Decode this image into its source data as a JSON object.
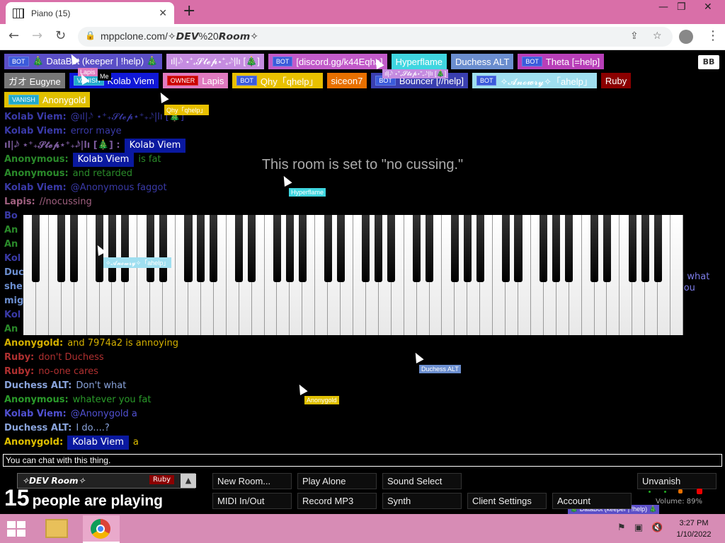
{
  "browser": {
    "tab_title": "Piano (15)",
    "url": "mppclone.com/✧𝘿𝙀𝙑%20𝙍𝙤𝙤𝙢✧"
  },
  "toggle_label": "BB",
  "users": [
    {
      "badge": "BOT",
      "name": "🎄 DataBot (keeper | !help) 🎄",
      "bg": "#5b4fc7",
      "fg": "#ffffff"
    },
    {
      "badge": "",
      "name": "ıl|𝆹𝅥𝅮 ⋆⁺₊𝓢𝓽𝓮𝓹⋆⁺₊𝆹𝅥𝅮|lı [🎄]",
      "bg": "#c58ce0",
      "fg": "#ffffff"
    },
    {
      "badge": "BOT",
      "name": "[discord.gg/k44Eqha]",
      "bg": "#c25bc9",
      "fg": "#ffffff"
    },
    {
      "badge": "",
      "name": "Hyperflame",
      "bg": "#3fd6e0",
      "fg": "#ffffff"
    },
    {
      "badge": "",
      "name": "Duchess ALT",
      "bg": "#6b8ecf",
      "fg": "#ffffff"
    },
    {
      "badge": "BOT",
      "name": "Theta [=help]",
      "bg": "#b83fb8",
      "fg": "#ffffff"
    },
    {
      "badge": "",
      "name": "ガオ Eugyne",
      "bg": "#777777",
      "fg": "#ffffff"
    },
    {
      "badge": "VANISH",
      "name": "Kolab Viem",
      "bg": "#1018d8",
      "fg": "#ffffff"
    },
    {
      "badge": "OWNER",
      "name": "Lapis",
      "bg": "#e07ac0",
      "fg": "#ffffff"
    },
    {
      "badge": "BOT",
      "name": "Qhy「qhelp」",
      "bg": "#e8c000",
      "fg": "#ffffff"
    },
    {
      "badge": "",
      "name": "siceon7",
      "bg": "#e87000",
      "fg": "#ffffff"
    },
    {
      "badge": "BOT",
      "name": "Bouncer [//help]",
      "bg": "#3a3fb0",
      "fg": "#ffffff"
    },
    {
      "badge": "BOT",
      "name": "✧𝓐𝓷𝓸𝔀𝓻𝔂✧「ahelp」",
      "bg": "#9fdff0",
      "fg": "#ffffff"
    },
    {
      "badge": "",
      "name": "Ruby",
      "bg": "#8b0000",
      "fg": "#ffffff"
    },
    {
      "badge": "VANISH",
      "name": "Anonygold",
      "bg": "#e0c000",
      "fg": "#ffffff"
    }
  ],
  "notice": "This room is set to \"no cussing.\"",
  "chat": [
    {
      "name": "Kolab Viem:",
      "name_color": "#3a3aa8",
      "highlight": "",
      "text": "@ıl|𝆹𝅥𝅮 ⋆⁺₊𝓢𝓽𝓮𝓹⋆⁺₊𝆹𝅥𝅮|lı [🎄]",
      "text_color": "#3a3aa8"
    },
    {
      "name": "Kolab Viem:",
      "name_color": "#3a3aa8",
      "highlight": "",
      "text": "error maye",
      "text_color": "#3a3aa8"
    },
    {
      "name": "ıl|𝆹𝅥𝅮 ⋆⁺₊𝓢𝓽𝓮𝓹⋆⁺₊𝆹𝅥𝅮|lı [🎄] :",
      "name_color": "#7a5a9a",
      "highlight": "Kolab Viem",
      "text": "",
      "text_color": "#7a5a9a"
    },
    {
      "name": "Anonymous:",
      "name_color": "#2a8a2a",
      "highlight": "Kolab Viem",
      "text": "is fat",
      "text_color": "#2a8a2a"
    },
    {
      "name": "Anonymous:",
      "name_color": "#2a8a2a",
      "highlight": "",
      "text": "and retarded",
      "text_color": "#2a8a2a"
    },
    {
      "name": "Kolab Viem:",
      "name_color": "#3a3aa8",
      "highlight": "",
      "text": "@Anonymous faggot",
      "text_color": "#3a3aa8"
    },
    {
      "name": "Lapis:",
      "name_color": "#a06080",
      "highlight": "",
      "text": "//nocussing",
      "text_color": "#a06080"
    },
    {
      "name": "Bo",
      "name_color": "#3a3aa8",
      "highlight": "",
      "text": "",
      "text_color": "#3a3aa8"
    },
    {
      "name": "An",
      "name_color": "#2a8a2a",
      "highlight": "",
      "text": "",
      "text_color": "#2a8a2a"
    },
    {
      "name": "An",
      "name_color": "#2a8a2a",
      "highlight": "",
      "text": "",
      "text_color": "#2a8a2a"
    },
    {
      "name": "Kol",
      "name_color": "#3a3aa8",
      "highlight": "",
      "text": "",
      "text_color": "#3a3aa8"
    },
    {
      "name": "Duc",
      "name_color": "#6b8ecf",
      "highlight": "",
      "text": "",
      "text_color": "#6b8ecf"
    },
    {
      "name": "she'",
      "name_color": "#6b8ecf",
      "highlight": "",
      "text": "",
      "text_color": "#6b8ecf"
    },
    {
      "name": "mig",
      "name_color": "#6b8ecf",
      "highlight": "",
      "text": "",
      "text_color": "#6b8ecf"
    },
    {
      "name": "Kol",
      "name_color": "#3a3aa8",
      "highlight": "",
      "text": "",
      "text_color": "#3a3aa8"
    },
    {
      "name": "An",
      "name_color": "#2a8a2a",
      "highlight": "",
      "text": "",
      "text_color": "#2a8a2a"
    },
    {
      "name": "Anonygold:",
      "name_color": "#d4b000",
      "highlight": "",
      "text": "and 7974a2 is annoying",
      "text_color": "#d4b000"
    },
    {
      "name": "Ruby:",
      "name_color": "#b03030",
      "highlight": "",
      "text": "don't Duchess",
      "text_color": "#b03030"
    },
    {
      "name": "Ruby:",
      "name_color": "#b03030",
      "highlight": "",
      "text": "no-one cares",
      "text_color": "#b03030"
    },
    {
      "name": "Duchess ALT:",
      "name_color": "#8aa4dc",
      "highlight": "",
      "text": "Don't what",
      "text_color": "#8aa4dc"
    },
    {
      "name": "Anonymous:",
      "name_color": "#2a9a2a",
      "highlight": "",
      "text": "whatever you fat",
      "text_color": "#2a9a2a"
    },
    {
      "name": "Kolab Viem:",
      "name_color": "#5050d0",
      "highlight": "",
      "text": "@Anonygold a",
      "text_color": "#5050d0"
    },
    {
      "name": "Duchess ALT:",
      "name_color": "#8aa4dc",
      "highlight": "",
      "text": "I do....?",
      "text_color": "#8aa4dc"
    },
    {
      "name": "Anonygold:",
      "name_color": "#e0c000",
      "highlight": "Kolab Viem",
      "text": "a",
      "text_color": "#e0c000"
    }
  ],
  "right_chat": [
    "d what",
    "you"
  ],
  "cursors": [
    {
      "label": "Lapis",
      "bg": "#e07ac0",
      "fg": "#ffffff"
    },
    {
      "label": "Me",
      "bg": "#000000",
      "fg": "#ffffff"
    },
    {
      "label": "ıl|𝆹𝅥𝅮 ⋆⁺₊𝓢𝓽𝓮𝓹⋆⁺₊𝆹𝅥𝅮|lı [🎄]",
      "bg": "#c58ce0",
      "fg": "#ffffff"
    },
    {
      "label": "Qhy「qhelp」",
      "bg": "#e8c000",
      "fg": "#ffffff"
    },
    {
      "label": "Hyperflame",
      "bg": "#3fd6e0",
      "fg": "#ffffff"
    },
    {
      "label": "✧𝓐𝓷𝓸𝔀𝓻𝔂✧「ahelp」",
      "bg": "#9fdff0",
      "fg": "#ffffff"
    },
    {
      "label": "Duchess ALT",
      "bg": "#6b8ecf",
      "fg": "#ffffff"
    },
    {
      "label": "Anonygold",
      "bg": "#e0c000",
      "fg": "#ffffff"
    },
    {
      "label": "🎄 DataBot (keeper | !help) 🎄",
      "bg": "#5b4fc7",
      "fg": "#ffffff"
    }
  ],
  "chat_input_placeholder": "You can chat with this thing.",
  "room": {
    "name": "✧𝘿𝙀𝙑 𝙍𝙤𝙤𝙢✧",
    "owner": "Ruby",
    "arrow": "▲"
  },
  "player_count": {
    "number": "15",
    "text": "people are playing"
  },
  "buttons": {
    "new_room": "New Room...",
    "play_alone": "Play Alone",
    "sound_select": "Sound Select",
    "midi": "MIDI In/Out",
    "record": "Record MP3",
    "synth": "Synth",
    "client_settings": "Client Settings",
    "account": "Account",
    "unvanish": "Unvanish"
  },
  "volume": "Volume: 89%",
  "taskbar": {
    "time": "3:27 PM",
    "date": "1/10/2022"
  },
  "colors": {
    "tab_bar": "#d96fa8",
    "taskbar": "#d78cb5"
  }
}
